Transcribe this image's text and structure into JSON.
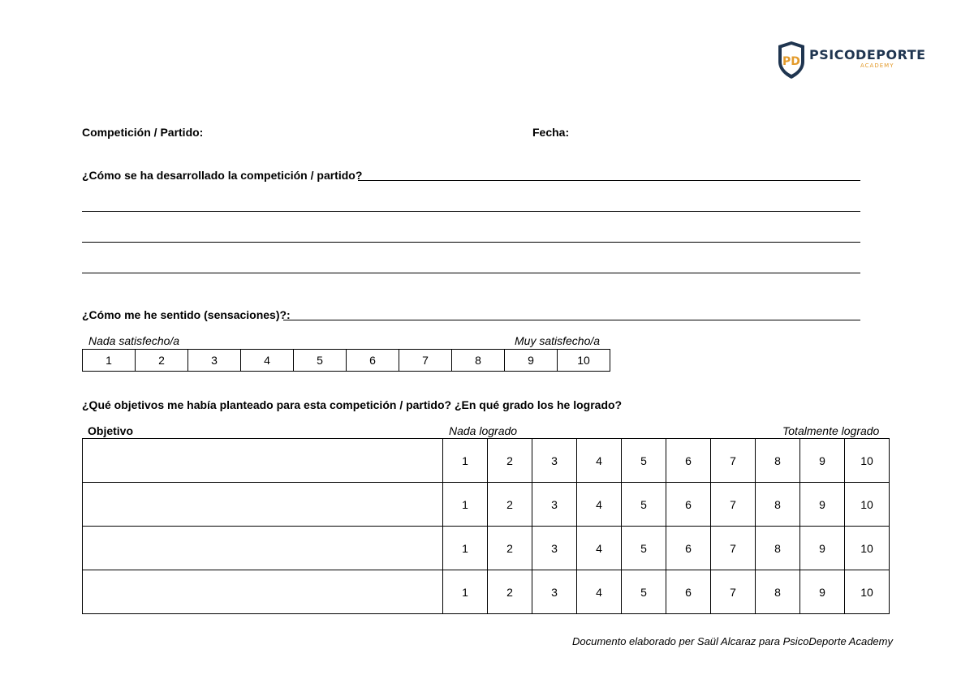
{
  "brand": {
    "logo_initials": "PD",
    "name": "PSICODEPORTE",
    "sub": "ACADEMY",
    "colors": {
      "navy": "#1f3550",
      "orange": "#e39b2c"
    }
  },
  "header": {
    "competition_label": "Competición / Partido:",
    "date_label": "Fecha:"
  },
  "q1": {
    "label": "¿Cómo se ha desarrollado la competición / partido?"
  },
  "q2": {
    "label": "¿Cómo me he sentido (sensaciones)?:",
    "scale_low": "Nada satisfecho/a",
    "scale_high": "Muy satisfecho/a",
    "scale": [
      "1",
      "2",
      "3",
      "4",
      "5",
      "6",
      "7",
      "8",
      "9",
      "10"
    ]
  },
  "q3": {
    "label": "¿Qué objetivos me había planteado para esta competición / partido? ¿En qué grado los he logrado?",
    "objective_header": "Objetivo",
    "scale_low": "Nada logrado",
    "scale_high": "Totalmente logrado",
    "rows": [
      {
        "objective": "",
        "scale": [
          "1",
          "2",
          "3",
          "4",
          "5",
          "6",
          "7",
          "8",
          "9",
          "10"
        ]
      },
      {
        "objective": "",
        "scale": [
          "1",
          "2",
          "3",
          "4",
          "5",
          "6",
          "7",
          "8",
          "9",
          "10"
        ]
      },
      {
        "objective": "",
        "scale": [
          "1",
          "2",
          "3",
          "4",
          "5",
          "6",
          "7",
          "8",
          "9",
          "10"
        ]
      },
      {
        "objective": "",
        "scale": [
          "1",
          "2",
          "3",
          "4",
          "5",
          "6",
          "7",
          "8",
          "9",
          "10"
        ]
      }
    ]
  },
  "footer": {
    "credit": "Documento elaborado per Saül Alcaraz para PsicoDeporte Academy"
  }
}
